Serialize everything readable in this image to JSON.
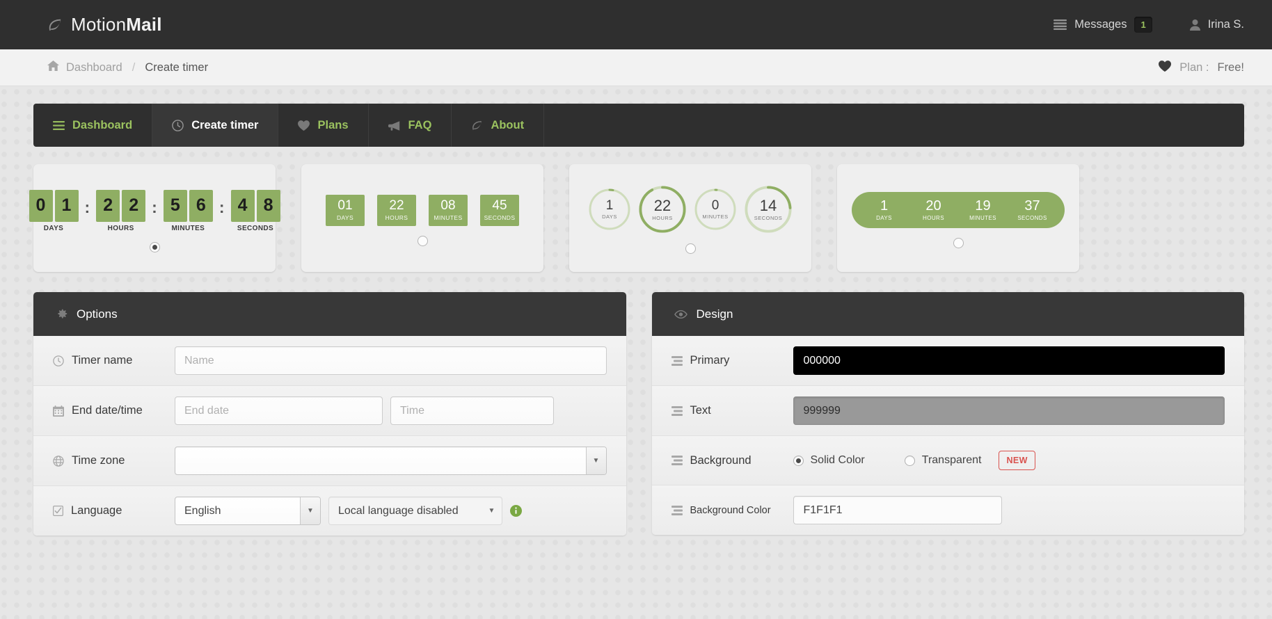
{
  "brand": {
    "name_light": "Motion",
    "name_bold": "Mail",
    "logo_icon": "leaf-icon"
  },
  "topbar": {
    "messages_label": "Messages",
    "messages_icon": "list-icon",
    "messages_count": "1",
    "user_name": "Irina S.",
    "user_icon": "user-icon"
  },
  "breadcrumb": {
    "home_icon": "home-icon",
    "home_label": "Dashboard",
    "separator": "/",
    "current": "Create timer",
    "plan_icon": "heart-icon",
    "plan_prefix": "Plan : ",
    "plan_value": "Free!"
  },
  "nav": {
    "items": [
      {
        "label": "Dashboard",
        "icon": "list-icon",
        "active": false
      },
      {
        "label": "Create timer",
        "icon": "clock-icon",
        "active": true
      },
      {
        "label": "Plans",
        "icon": "heart-icon",
        "active": false
      },
      {
        "label": "FAQ",
        "icon": "megaphone-icon",
        "active": false
      },
      {
        "label": "About",
        "icon": "leaf-icon",
        "active": false
      }
    ]
  },
  "previews": [
    {
      "style": "digits",
      "selected": true,
      "groups": [
        {
          "digits": [
            "0",
            "1"
          ],
          "label": "DAYS"
        },
        {
          "digits": [
            "2",
            "2"
          ],
          "label": "HOURS"
        },
        {
          "digits": [
            "5",
            "6"
          ],
          "label": "MINUTES"
        },
        {
          "digits": [
            "4",
            "8"
          ],
          "label": "SECONDS"
        }
      ],
      "separator": ":"
    },
    {
      "style": "blocks",
      "selected": false,
      "cells": [
        {
          "value": "01",
          "label": "DAYS"
        },
        {
          "value": "22",
          "label": "HOURS"
        },
        {
          "value": "08",
          "label": "MINUTES"
        },
        {
          "value": "45",
          "label": "SECONDS"
        }
      ]
    },
    {
      "style": "rings",
      "selected": false,
      "cells": [
        {
          "value": "1",
          "label": "DAYS",
          "pct": 3
        },
        {
          "value": "22",
          "label": "HOURS",
          "pct": 92
        },
        {
          "value": "0",
          "label": "MINUTES",
          "pct": 1
        },
        {
          "value": "14",
          "label": "SECONDS",
          "pct": 24
        }
      ]
    },
    {
      "style": "pill",
      "selected": false,
      "cells": [
        {
          "value": "1",
          "label": "DAYS"
        },
        {
          "value": "20",
          "label": "HOURS"
        },
        {
          "value": "19",
          "label": "MINUTES"
        },
        {
          "value": "37",
          "label": "SECONDS"
        }
      ]
    }
  ],
  "options_panel": {
    "title": "Options",
    "icon": "gear-icon",
    "timer_name": {
      "label": "Timer name",
      "icon": "clock-icon",
      "value": "",
      "placeholder": "Name"
    },
    "end_datetime": {
      "label": "End date/time",
      "icon": "calendar-icon",
      "date_value": "",
      "date_placeholder": "End date",
      "time_value": "",
      "time_placeholder": "Time"
    },
    "time_zone": {
      "label": "Time zone",
      "icon": "globe-icon",
      "value": "",
      "arrow_icon": "chevron-down-icon"
    },
    "language": {
      "label": "Language",
      "icon": "checkbox-icon",
      "primary_value": "English",
      "local_value": "Local language disabled",
      "info_icon": "info-icon",
      "arrow_icon": "chevron-down-icon"
    }
  },
  "design_panel": {
    "title": "Design",
    "icon": "eye-icon",
    "primary": {
      "label": "Primary",
      "icon": "sliders-icon",
      "value": "000000",
      "swatch": "#000000"
    },
    "text": {
      "label": "Text",
      "icon": "sliders-icon",
      "value": "999999",
      "swatch": "#999999"
    },
    "background": {
      "label": "Background",
      "icon": "sliders-icon",
      "solid_label": "Solid Color",
      "solid_selected": true,
      "transparent_label": "Transparent",
      "transparent_selected": false,
      "new_badge": "NEW"
    },
    "background_color": {
      "label": "Background Color",
      "icon": "sliders-icon",
      "value": "F1F1F1",
      "swatch": "#F1F1F1"
    }
  },
  "colors": {
    "accent_green": "#9bc25f",
    "timer_green": "#8fae63",
    "dark_bar": "#2f2f2f",
    "panel_head": "#383838",
    "new_red": "#d9534f"
  }
}
